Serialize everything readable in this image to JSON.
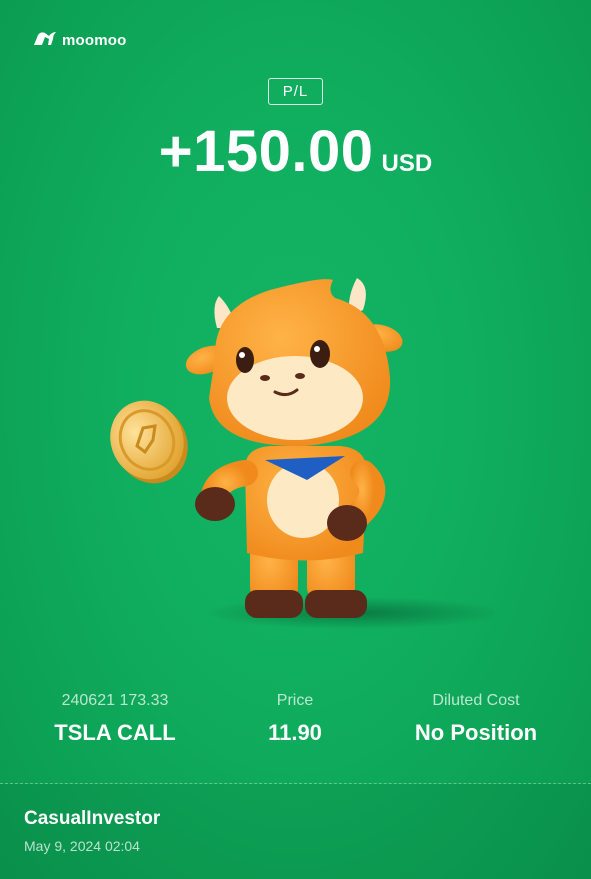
{
  "brand": {
    "name": "moomoo",
    "logo_icon": "moomoo-bull-icon"
  },
  "pl": {
    "label": "P/L",
    "amount": "+150.00",
    "currency": "USD"
  },
  "illustration": {
    "subject": "moomoo-mascot-with-coin"
  },
  "stats": [
    {
      "label": "240621 173.33",
      "value": "TSLA CALL"
    },
    {
      "label": "Price",
      "value": "11.90"
    },
    {
      "label": "Diluted Cost",
      "value": "No Position"
    }
  ],
  "user": {
    "name": "CasualInvestor",
    "timestamp": "May 9, 2024 02:04"
  },
  "colors": {
    "background": "#10ad5e",
    "text": "#ffffff"
  }
}
